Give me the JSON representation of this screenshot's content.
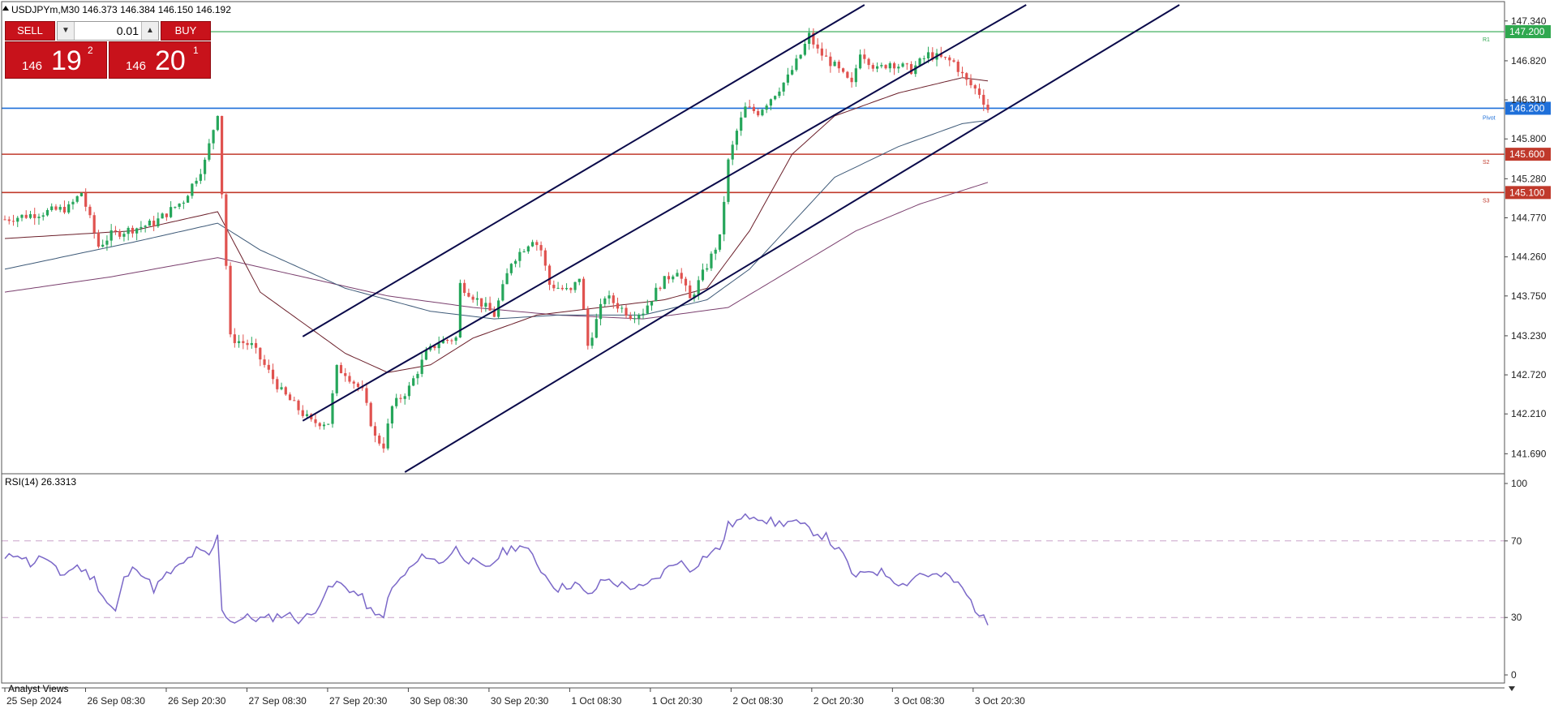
{
  "header": {
    "symbol_line": "USDJPYm,M30  146.373 146.384 146.150 146.192",
    "indicator_label": "RSI(14) 26.3313",
    "bottom_label": "Analyst Views"
  },
  "trade_panel": {
    "sell_label": "SELL",
    "buy_label": "BUY",
    "lot": "0.01",
    "bid_prefix": "146",
    "bid_big": "19",
    "bid_sup": "2",
    "ask_prefix": "146",
    "ask_big": "20",
    "ask_sup": "1"
  },
  "colors": {
    "bull": "#26a65b",
    "bear": "#e0524f",
    "channel": "#0a0a4a",
    "ma_fast": "#6b1f2a",
    "ma_mid": "#3e5a78",
    "ma_slow": "#7a3f6e",
    "rsi": "#7b68c8",
    "r1": "#2fa84f",
    "pivot": "#1e6fd9",
    "support": "#c0392b"
  },
  "chart_data": {
    "type": "candlestick",
    "symbol": "USDJPYm",
    "timeframe": "M30",
    "ylim": [
      141.45,
      147.55
    ],
    "y_ticks": [
      "147.340",
      "146.820",
      "146.310",
      "145.800",
      "145.280",
      "144.770",
      "144.260",
      "143.750",
      "143.230",
      "142.720",
      "142.210",
      "141.690"
    ],
    "x_ticks": [
      "25 Sep 2024",
      "26 Sep 08:30",
      "26 Sep 20:30",
      "27 Sep 08:30",
      "27 Sep 20:30",
      "30 Sep 08:30",
      "30 Sep 20:30",
      "1 Oct 08:30",
      "1 Oct 20:30",
      "2 Oct 08:30",
      "2 Oct 20:30",
      "3 Oct 08:30",
      "3 Oct 20:30"
    ],
    "candle_count": 232,
    "anchors": [
      [
        0,
        144.75
      ],
      [
        15,
        144.9
      ],
      [
        18,
        145.1
      ],
      [
        22,
        144.4
      ],
      [
        25,
        144.55
      ],
      [
        35,
        144.7
      ],
      [
        42,
        145.0
      ],
      [
        47,
        145.5
      ],
      [
        50,
        146.15
      ],
      [
        51,
        145.1
      ],
      [
        53,
        143.2
      ],
      [
        58,
        143.1
      ],
      [
        65,
        142.5
      ],
      [
        72,
        142.1
      ],
      [
        76,
        142.1
      ],
      [
        78,
        142.8
      ],
      [
        80,
        142.75
      ],
      [
        84,
        142.5
      ],
      [
        87,
        141.9
      ],
      [
        89,
        141.8
      ],
      [
        91,
        142.3
      ],
      [
        95,
        142.55
      ],
      [
        99,
        143.0
      ],
      [
        102,
        143.15
      ],
      [
        106,
        143.2
      ],
      [
        107,
        143.9
      ],
      [
        110,
        143.75
      ],
      [
        115,
        143.5
      ],
      [
        119,
        144.2
      ],
      [
        124,
        144.5
      ],
      [
        126,
        144.35
      ],
      [
        128,
        143.9
      ],
      [
        133,
        143.8
      ],
      [
        135,
        144.0
      ],
      [
        137,
        143.1
      ],
      [
        141,
        143.75
      ],
      [
        147,
        143.5
      ],
      [
        150,
        143.55
      ],
      [
        154,
        143.9
      ],
      [
        158,
        144.1
      ],
      [
        161,
        143.7
      ],
      [
        165,
        144.15
      ],
      [
        168,
        144.5
      ],
      [
        170,
        145.5
      ],
      [
        172,
        145.9
      ],
      [
        174,
        146.2
      ],
      [
        177,
        146.15
      ],
      [
        181,
        146.4
      ],
      [
        184,
        146.6
      ],
      [
        187,
        146.9
      ],
      [
        189,
        147.15
      ],
      [
        191,
        146.95
      ],
      [
        195,
        146.75
      ],
      [
        199,
        146.5
      ],
      [
        201,
        146.95
      ],
      [
        205,
        146.7
      ],
      [
        208,
        146.8
      ],
      [
        213,
        146.7
      ],
      [
        217,
        146.9
      ],
      [
        223,
        146.8
      ],
      [
        226,
        146.55
      ],
      [
        229,
        146.4
      ],
      [
        231,
        146.19
      ]
    ],
    "channel_lines": [
      {
        "name": "upper",
        "x": [
          70,
          202
        ],
        "y": [
          143.22,
          147.55
        ]
      },
      {
        "name": "middle",
        "x": [
          70,
          240
        ],
        "y": [
          142.12,
          147.55
        ]
      },
      {
        "name": "lower",
        "x": [
          94,
          276
        ],
        "y": [
          141.45,
          147.55
        ]
      }
    ],
    "ma_fast_anchors": [
      [
        0,
        144.5
      ],
      [
        30,
        144.6
      ],
      [
        50,
        144.85
      ],
      [
        60,
        143.8
      ],
      [
        80,
        143.0
      ],
      [
        90,
        142.75
      ],
      [
        100,
        142.85
      ],
      [
        110,
        143.2
      ],
      [
        125,
        143.5
      ],
      [
        140,
        143.6
      ],
      [
        155,
        143.7
      ],
      [
        165,
        143.85
      ],
      [
        175,
        144.6
      ],
      [
        185,
        145.6
      ],
      [
        195,
        146.1
      ],
      [
        210,
        146.4
      ],
      [
        225,
        146.6
      ],
      [
        232,
        146.55
      ]
    ],
    "ma_mid_anchors": [
      [
        0,
        144.1
      ],
      [
        30,
        144.45
      ],
      [
        50,
        144.7
      ],
      [
        60,
        144.35
      ],
      [
        80,
        143.85
      ],
      [
        100,
        143.55
      ],
      [
        115,
        143.45
      ],
      [
        130,
        143.5
      ],
      [
        150,
        143.5
      ],
      [
        165,
        143.7
      ],
      [
        175,
        144.1
      ],
      [
        185,
        144.7
      ],
      [
        195,
        145.3
      ],
      [
        210,
        145.7
      ],
      [
        225,
        146.0
      ],
      [
        232,
        146.05
      ]
    ],
    "ma_slow_anchors": [
      [
        0,
        143.8
      ],
      [
        25,
        144.0
      ],
      [
        50,
        144.25
      ],
      [
        70,
        144.0
      ],
      [
        90,
        143.75
      ],
      [
        110,
        143.6
      ],
      [
        130,
        143.5
      ],
      [
        150,
        143.45
      ],
      [
        170,
        143.6
      ],
      [
        185,
        144.1
      ],
      [
        200,
        144.6
      ],
      [
        215,
        144.95
      ],
      [
        232,
        145.25
      ]
    ],
    "levels": [
      {
        "name": "R1",
        "value": 147.2,
        "label": "147.200"
      },
      {
        "name": "Pivot",
        "value": 146.2,
        "label": "146.200"
      },
      {
        "name": "S2",
        "value": 145.6,
        "label": "145.600"
      },
      {
        "name": "S3",
        "value": 145.1,
        "label": "145.100"
      }
    ],
    "rsi": {
      "period": 14,
      "last": 26.3313,
      "y_ticks": [
        "100",
        "70",
        "30",
        "0"
      ],
      "levels": [
        70,
        30
      ],
      "anchors": [
        [
          0,
          60
        ],
        [
          3,
          64
        ],
        [
          6,
          58
        ],
        [
          9,
          62
        ],
        [
          13,
          52
        ],
        [
          17,
          57
        ],
        [
          21,
          50
        ],
        [
          24,
          38
        ],
        [
          26,
          33
        ],
        [
          28,
          50
        ],
        [
          31,
          57
        ],
        [
          35,
          45
        ],
        [
          38,
          52
        ],
        [
          42,
          58
        ],
        [
          45,
          65
        ],
        [
          48,
          62
        ],
        [
          50,
          72
        ],
        [
          51,
          35
        ],
        [
          53,
          28
        ],
        [
          57,
          30
        ],
        [
          61,
          29
        ],
        [
          66,
          32
        ],
        [
          69,
          29
        ],
        [
          72,
          31
        ],
        [
          75,
          42
        ],
        [
          78,
          48
        ],
        [
          81,
          45
        ],
        [
          84,
          40
        ],
        [
          87,
          30
        ],
        [
          89,
          32
        ],
        [
          91,
          45
        ],
        [
          95,
          55
        ],
        [
          99,
          63
        ],
        [
          102,
          58
        ],
        [
          106,
          66
        ],
        [
          109,
          60
        ],
        [
          113,
          55
        ],
        [
          117,
          64
        ],
        [
          121,
          68
        ],
        [
          124,
          62
        ],
        [
          127,
          52
        ],
        [
          130,
          45
        ],
        [
          134,
          48
        ],
        [
          137,
          41
        ],
        [
          141,
          50
        ],
        [
          145,
          47
        ],
        [
          150,
          45
        ],
        [
          154,
          52
        ],
        [
          158,
          60
        ],
        [
          161,
          55
        ],
        [
          165,
          63
        ],
        [
          168,
          66
        ],
        [
          170,
          78
        ],
        [
          172,
          80
        ],
        [
          176,
          84
        ],
        [
          181,
          79
        ],
        [
          185,
          80
        ],
        [
          189,
          76
        ],
        [
          193,
          72
        ],
        [
          197,
          62
        ],
        [
          200,
          50
        ],
        [
          203,
          55
        ],
        [
          207,
          53
        ],
        [
          211,
          47
        ],
        [
          215,
          53
        ],
        [
          218,
          52
        ],
        [
          222,
          51
        ],
        [
          225,
          45
        ],
        [
          228,
          35
        ],
        [
          231,
          26
        ]
      ]
    }
  }
}
